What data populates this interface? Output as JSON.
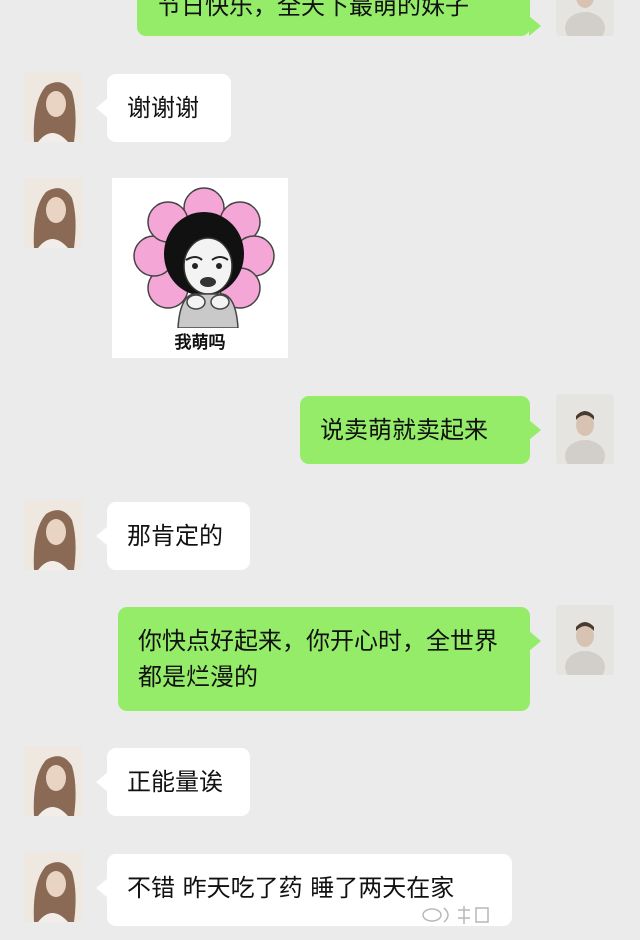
{
  "chat": {
    "messages": [
      {
        "sender": "me",
        "text": "节日快乐，全天下最萌的妹子"
      },
      {
        "sender": "friend",
        "text": "谢谢谢"
      },
      {
        "sender": "friend",
        "type": "sticker",
        "caption": "我萌吗"
      },
      {
        "sender": "me",
        "text": "说卖萌就卖起来"
      },
      {
        "sender": "friend",
        "text": "那肯定的"
      },
      {
        "sender": "me",
        "text": "你快点好起来，你开心时，全世界都是烂漫的"
      },
      {
        "sender": "friend",
        "text": "正能量诶"
      },
      {
        "sender": "friend",
        "text": "不错 昨天吃了药 睡了两天在家"
      }
    ]
  },
  "colors": {
    "background": "#ebebeb",
    "incoming_bubble": "#ffffff",
    "outgoing_bubble": "#95ec69",
    "sticker_petals": "#f4a6d6"
  }
}
